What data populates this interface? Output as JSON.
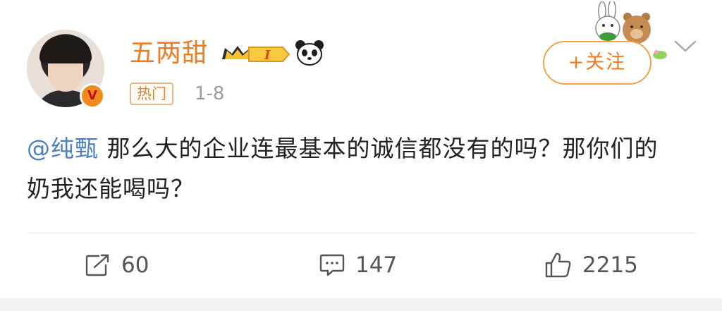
{
  "post": {
    "username": "五两甜",
    "vip_label": "I",
    "hot_tag": "热门",
    "time": "1-8",
    "verified_badge": "V",
    "follow_label": "+关注",
    "content": {
      "mention": "@纯甄",
      "text": " 那么大的企业连最基本的诚信都没有的吗？那你们的奶我还能喝吗？"
    },
    "actions": {
      "repost_count": "60",
      "comment_count": "147",
      "like_count": "2215"
    },
    "icons": [
      "avatar",
      "verified-badge-icon",
      "vip-crown-icon",
      "panda-icon",
      "bunny-bear-decoration",
      "chevron-down-icon",
      "repost-icon",
      "comment-icon",
      "like-icon"
    ],
    "colors": {
      "username": "#ef7b22",
      "mention": "#4a7fc1",
      "follow_border": "#f2a24a",
      "hot_tag_border": "#e3b88a"
    }
  }
}
